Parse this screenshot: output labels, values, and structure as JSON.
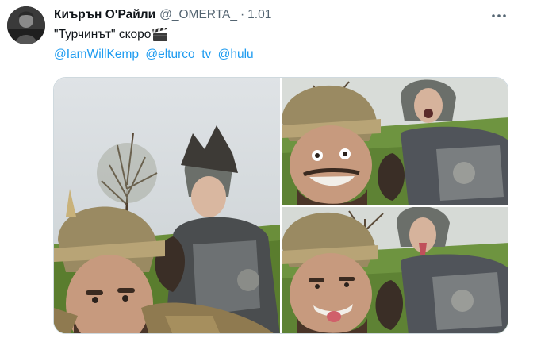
{
  "tweet": {
    "display_name": "Киърън О'Райли",
    "handle": "@_OMERTA_",
    "separator": "·",
    "time": "1.01",
    "text": "\"Турчинът\" скоро",
    "text_emoji": "clapper-board-icon",
    "mentions": [
      "@IamWillKemp",
      "@elturco_tv",
      "@hulu"
    ]
  },
  "colors": {
    "link": "#1d9bf0",
    "secondary_text": "#536471",
    "border": "#cfd9de"
  },
  "media": {
    "photo_count": 3
  }
}
